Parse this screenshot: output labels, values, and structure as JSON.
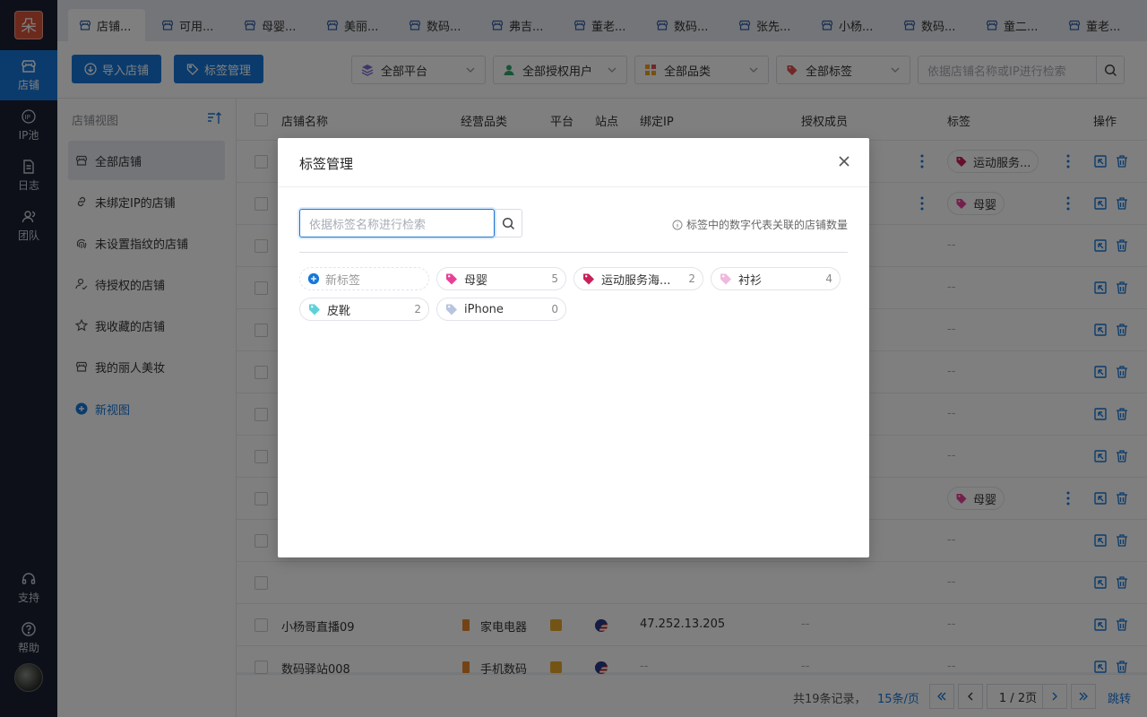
{
  "rail": {
    "logo": "朵",
    "items": [
      {
        "label": "店铺",
        "icon": "store-icon"
      },
      {
        "label": "IP池",
        "icon": "ip-icon"
      },
      {
        "label": "日志",
        "icon": "log-icon"
      },
      {
        "label": "团队",
        "icon": "team-icon"
      }
    ],
    "bottom": [
      {
        "label": "支持",
        "icon": "headset-icon"
      },
      {
        "label": "帮助",
        "icon": "help-icon"
      }
    ]
  },
  "tabs": [
    "店铺...",
    "可用...",
    "母婴...",
    "美丽...",
    "数码...",
    "弗吉...",
    "董老...",
    "数码...",
    "张先...",
    "小杨...",
    "数码...",
    "童二...",
    "董老..."
  ],
  "toolbar": {
    "import_label": "导入店铺",
    "tag_manage_label": "标签管理",
    "filter_platform": "全部平台",
    "filter_users": "全部授权用户",
    "filter_category": "全部品类",
    "filter_tags": "全部标签",
    "search_placeholder": "依据店铺名称或IP进行检索"
  },
  "sidepanel": {
    "title": "店铺视图",
    "items": [
      "全部店铺",
      "未绑定IP的店铺",
      "未设置指纹的店铺",
      "待授权的店铺",
      "我收藏的店铺",
      "我的丽人美妆"
    ],
    "new_view": "新视图"
  },
  "table": {
    "headers": {
      "name": "店铺名称",
      "category": "经营品类",
      "platform": "平台",
      "site": "站点",
      "ip": "绑定IP",
      "members": "授权成员",
      "tags": "标签",
      "actions": "操作"
    },
    "empty": "--",
    "row_tags": {
      "r0": "运动服务...",
      "r1": "母婴",
      "r8": "母婴"
    },
    "rows_visible": [
      {
        "name": "小杨哥直播09",
        "category": "家电电器",
        "ip": "47.252.13.205",
        "members": "--",
        "tags": "--"
      },
      {
        "name": "数码驿站008",
        "category": "手机数码",
        "ip": "--",
        "members": "--",
        "tags": "--"
      }
    ]
  },
  "pager": {
    "total": "共19条记录，",
    "per_page": "15条/页",
    "page": "1 / 2页",
    "jump": "跳转"
  },
  "modal": {
    "title": "标签管理",
    "search_placeholder": "依据标签名称进行检索",
    "hint": "标签中的数字代表关联的店铺数量",
    "new_tag": "新标签",
    "tags": [
      {
        "label": "母婴",
        "count": "5",
        "color": "#e8409a"
      },
      {
        "label": "运动服务海...",
        "count": "2",
        "color": "#c8205a"
      },
      {
        "label": "衬衫",
        "count": "4",
        "color": "#f0b8dc"
      },
      {
        "label": "皮靴",
        "count": "2",
        "color": "#5fd2d8"
      },
      {
        "label": "iPhone",
        "count": "0",
        "color": "#b8c4e0"
      }
    ]
  },
  "colors": {
    "primary": "#1677d8",
    "rail_bg": "#1b2130"
  }
}
